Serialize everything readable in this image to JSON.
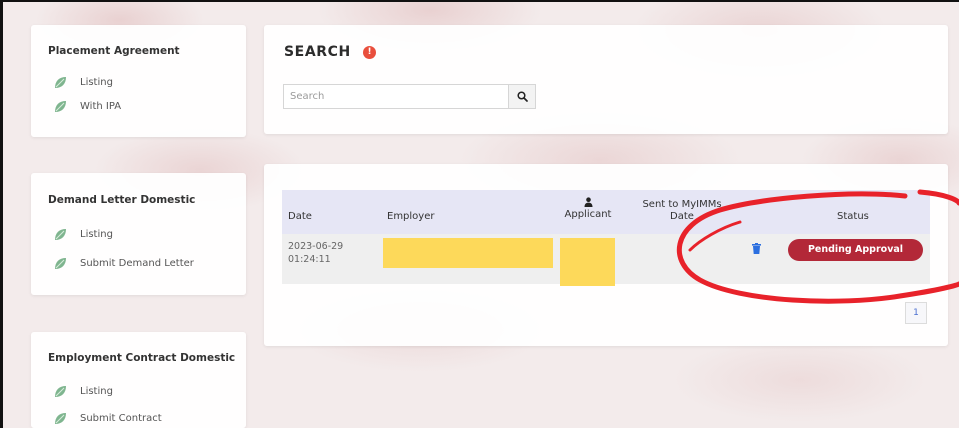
{
  "sidebar": {
    "sections": [
      {
        "title": "Placement Agreement",
        "items": [
          {
            "label": "Listing"
          },
          {
            "label": "With IPA"
          }
        ]
      },
      {
        "title": "Demand Letter Domestic",
        "items": [
          {
            "label": "Listing"
          },
          {
            "label": "Submit Demand Letter"
          }
        ]
      },
      {
        "title": "Employment Contract Domestic",
        "items": [
          {
            "label": "Listing"
          },
          {
            "label": "Submit Contract"
          }
        ]
      }
    ]
  },
  "search": {
    "title": "SEARCH",
    "info_icon": "!",
    "placeholder": "Search",
    "value": ""
  },
  "table": {
    "columns": {
      "date": "Date",
      "employer": "Employer",
      "applicant": "Applicant",
      "sent_line1": "Sent to MyIMMs",
      "sent_line2": "Date",
      "status": "Status"
    },
    "rows": [
      {
        "date": "2023-06-29",
        "time": "01:24:11",
        "employer": "",
        "applicant": "",
        "sent_date": "",
        "status": "Pending Approval"
      }
    ],
    "pagination": {
      "current_page": "1"
    }
  },
  "colors": {
    "accent": "#b32838",
    "header_bg": "#e6e6f5",
    "redaction": "#fdd95a",
    "annotation": "#e8222a",
    "trash_icon": "#2b6fe0",
    "info_icon": "#e94f3d"
  },
  "icons": {
    "sidebar_item": "leaf-icon",
    "search": "search-icon",
    "applicant_header": "user-icon",
    "row_action": "trash-icon"
  }
}
